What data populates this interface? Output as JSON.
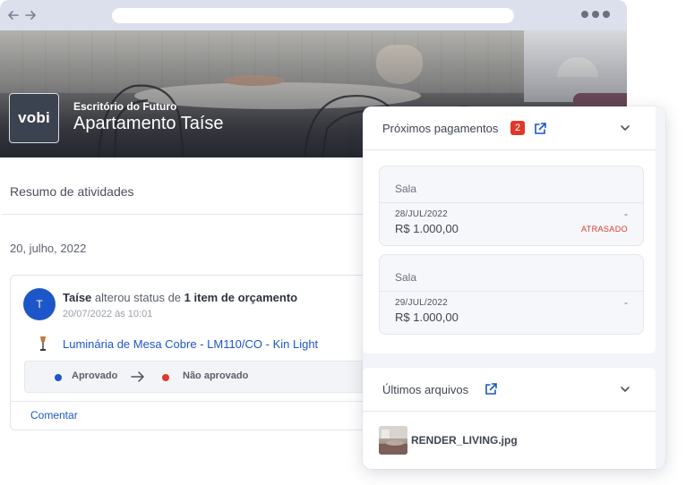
{
  "hero": {
    "logo_text": "vobi",
    "company": "Escritório do Futuro",
    "project": "Apartamento Taíse"
  },
  "activity": {
    "section_title": "Resumo de atividades",
    "date": "20, julho, 2022",
    "entry": {
      "avatar_initial": "T",
      "user": "Taíse",
      "action": "alterou status de",
      "object": "1 item de orçamento",
      "timestamp": "20/07/2022 às 10:01",
      "item_name": "Luminária de Mesa Cobre - LM110/CO - Kin Light",
      "status_from": "Aprovado",
      "status_to": "Não aprovado",
      "comment_label": "Comentar"
    }
  },
  "payments": {
    "title": "Próximos pagamentos",
    "count": "2",
    "items": [
      {
        "name": "Sala",
        "date": "28/JUL/2022",
        "amount": "R$ 1.000,00",
        "extra": "-",
        "status": "ATRASADO"
      },
      {
        "name": "Sala",
        "date": "29/JUL/2022",
        "amount": "R$ 1.000,00",
        "extra": "-",
        "status": ""
      }
    ]
  },
  "files": {
    "title": "Últimos arquivos",
    "items": [
      {
        "name": "RENDER_LIVING.jpg"
      }
    ]
  },
  "colors": {
    "accent": "#1d56c8",
    "danger": "#e0392b",
    "browser_chrome": "#dcdfec"
  }
}
